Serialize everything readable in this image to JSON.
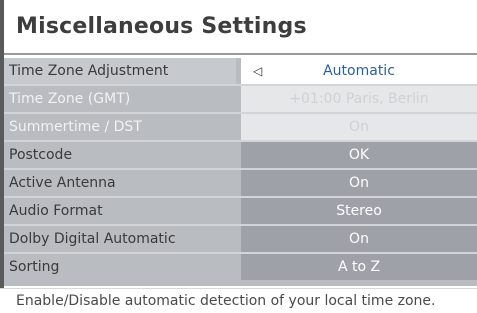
{
  "title": "Miscellaneous Settings",
  "settings": [
    {
      "label": "Time Zone Adjustment",
      "value": "Automatic"
    },
    {
      "label": "Time Zone (GMT)",
      "value": "+01:00  Paris, Berlin"
    },
    {
      "label": "Summertime / DST",
      "value": "On"
    },
    {
      "label": "Postcode",
      "value": "OK"
    },
    {
      "label": "Active Antenna",
      "value": "On"
    },
    {
      "label": "Audio Format",
      "value": "Stereo"
    },
    {
      "label": "Dolby Digital Automatic",
      "value": "On"
    },
    {
      "label": "Sorting",
      "value": "A to Z"
    }
  ],
  "left_arrow_icon": "◁",
  "help_text": "Enable/Disable automatic detection of your local time zone.",
  "colors": {
    "selected_value_text": "#2c5fa0",
    "row_label_bg": "#b9bcc1",
    "row_value_bg": "#9ea2a8"
  }
}
